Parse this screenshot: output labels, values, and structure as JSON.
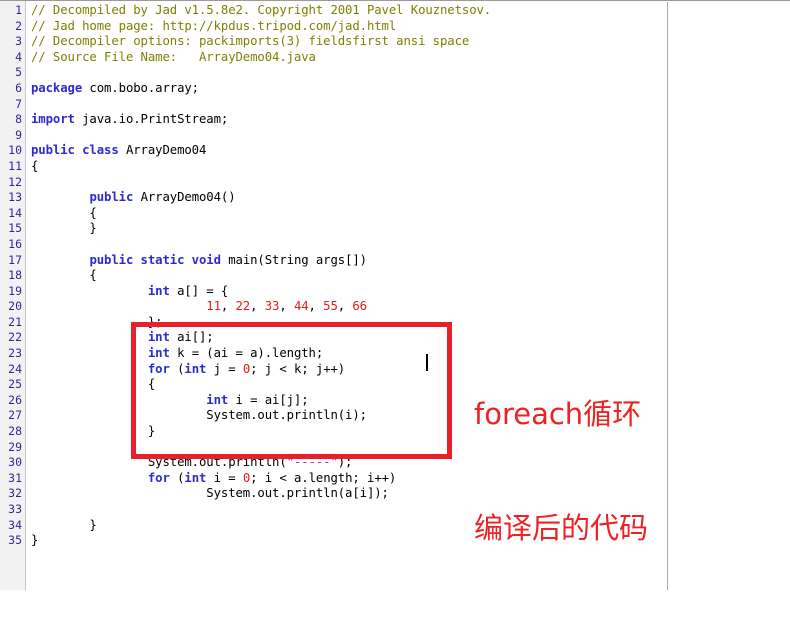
{
  "editor": {
    "file_name": "ArrayDemo04.java",
    "total_lines": 35,
    "line_numbers": [
      "1",
      "2",
      "3",
      "4",
      "5",
      "6",
      "7",
      "8",
      "9",
      "10",
      "11",
      "12",
      "13",
      "14",
      "15",
      "16",
      "17",
      "18",
      "19",
      "20",
      "21",
      "22",
      "23",
      "24",
      "25",
      "26",
      "27",
      "28",
      "29",
      "30",
      "31",
      "32",
      "33",
      "34",
      "35"
    ],
    "colors": {
      "comment": "#808000",
      "keyword": "#2b2bd0",
      "number": "#e01b1b",
      "string": "#c020c0",
      "plain": "#000000",
      "gutter_bg": "#f2f2f2",
      "gutter_text": "#2b2b8f",
      "background": "#ffffff",
      "annotation_red": "#ee2222",
      "highlight_box": "#e8202a"
    },
    "lines": [
      {
        "n": "1",
        "tokens": [
          {
            "t": "comment",
            "s": "// Decompiled by Jad v1.5.8e2. Copyright 2001 Pavel Kouznetsov."
          }
        ]
      },
      {
        "n": "2",
        "tokens": [
          {
            "t": "comment",
            "s": "// Jad home page: http://kpdus.tripod.com/jad.html"
          }
        ]
      },
      {
        "n": "3",
        "tokens": [
          {
            "t": "comment",
            "s": "// Decompiler options: packimports(3) fieldsfirst ansi space"
          }
        ]
      },
      {
        "n": "4",
        "tokens": [
          {
            "t": "comment",
            "s": "// Source File Name:   ArrayDemo04.java"
          }
        ]
      },
      {
        "n": "5",
        "tokens": [
          {
            "t": "plain",
            "s": ""
          }
        ]
      },
      {
        "n": "6",
        "tokens": [
          {
            "t": "keyword",
            "s": "package"
          },
          {
            "t": "plain",
            "s": " com.bobo.array;"
          }
        ]
      },
      {
        "n": "7",
        "tokens": [
          {
            "t": "plain",
            "s": ""
          }
        ]
      },
      {
        "n": "8",
        "tokens": [
          {
            "t": "keyword",
            "s": "import"
          },
          {
            "t": "plain",
            "s": " java.io.PrintStream;"
          }
        ]
      },
      {
        "n": "9",
        "tokens": [
          {
            "t": "plain",
            "s": ""
          }
        ]
      },
      {
        "n": "10",
        "tokens": [
          {
            "t": "keyword",
            "s": "public class"
          },
          {
            "t": "plain",
            "s": " ArrayDemo04"
          }
        ]
      },
      {
        "n": "11",
        "tokens": [
          {
            "t": "plain",
            "s": "{"
          }
        ]
      },
      {
        "n": "12",
        "tokens": [
          {
            "t": "plain",
            "s": ""
          }
        ]
      },
      {
        "n": "13",
        "tokens": [
          {
            "t": "plain",
            "s": "        "
          },
          {
            "t": "keyword",
            "s": "public"
          },
          {
            "t": "plain",
            "s": " ArrayDemo04()"
          }
        ]
      },
      {
        "n": "14",
        "tokens": [
          {
            "t": "plain",
            "s": "        {"
          }
        ]
      },
      {
        "n": "15",
        "tokens": [
          {
            "t": "plain",
            "s": "        }"
          }
        ]
      },
      {
        "n": "16",
        "tokens": [
          {
            "t": "plain",
            "s": ""
          }
        ]
      },
      {
        "n": "17",
        "tokens": [
          {
            "t": "plain",
            "s": "        "
          },
          {
            "t": "keyword",
            "s": "public static void"
          },
          {
            "t": "plain",
            "s": " main(String args[])"
          }
        ]
      },
      {
        "n": "18",
        "tokens": [
          {
            "t": "plain",
            "s": "        {"
          }
        ]
      },
      {
        "n": "19",
        "tokens": [
          {
            "t": "plain",
            "s": "                "
          },
          {
            "t": "keyword",
            "s": "int"
          },
          {
            "t": "plain",
            "s": " a[] = {"
          }
        ]
      },
      {
        "n": "20",
        "tokens": [
          {
            "t": "plain",
            "s": "                        "
          },
          {
            "t": "number",
            "s": "11"
          },
          {
            "t": "plain",
            "s": ", "
          },
          {
            "t": "number",
            "s": "22"
          },
          {
            "t": "plain",
            "s": ", "
          },
          {
            "t": "number",
            "s": "33"
          },
          {
            "t": "plain",
            "s": ", "
          },
          {
            "t": "number",
            "s": "44"
          },
          {
            "t": "plain",
            "s": ", "
          },
          {
            "t": "number",
            "s": "55"
          },
          {
            "t": "plain",
            "s": ", "
          },
          {
            "t": "number",
            "s": "66"
          }
        ]
      },
      {
        "n": "21",
        "tokens": [
          {
            "t": "plain",
            "s": "                };"
          }
        ]
      },
      {
        "n": "22",
        "tokens": [
          {
            "t": "plain",
            "s": "                "
          },
          {
            "t": "keyword",
            "s": "int"
          },
          {
            "t": "plain",
            "s": " ai[];"
          }
        ]
      },
      {
        "n": "23",
        "tokens": [
          {
            "t": "plain",
            "s": "                "
          },
          {
            "t": "keyword",
            "s": "int"
          },
          {
            "t": "plain",
            "s": " k = (ai = a).length;"
          }
        ]
      },
      {
        "n": "24",
        "tokens": [
          {
            "t": "plain",
            "s": "                "
          },
          {
            "t": "keyword",
            "s": "for"
          },
          {
            "t": "plain",
            "s": " ("
          },
          {
            "t": "keyword",
            "s": "int"
          },
          {
            "t": "plain",
            "s": " j = "
          },
          {
            "t": "number",
            "s": "0"
          },
          {
            "t": "plain",
            "s": "; j < k; j++)"
          }
        ]
      },
      {
        "n": "25",
        "tokens": [
          {
            "t": "plain",
            "s": "                {"
          }
        ]
      },
      {
        "n": "26",
        "tokens": [
          {
            "t": "plain",
            "s": "                        "
          },
          {
            "t": "keyword",
            "s": "int"
          },
          {
            "t": "plain",
            "s": " i = ai[j];"
          }
        ]
      },
      {
        "n": "27",
        "tokens": [
          {
            "t": "plain",
            "s": "                        System.out.println(i);"
          }
        ]
      },
      {
        "n": "28",
        "tokens": [
          {
            "t": "plain",
            "s": "                }"
          }
        ]
      },
      {
        "n": "29",
        "tokens": [
          {
            "t": "plain",
            "s": ""
          }
        ]
      },
      {
        "n": "30",
        "tokens": [
          {
            "t": "plain",
            "s": "                System.out.println("
          },
          {
            "t": "string",
            "s": "\"-----\""
          },
          {
            "t": "plain",
            "s": ");"
          }
        ]
      },
      {
        "n": "31",
        "tokens": [
          {
            "t": "plain",
            "s": "                "
          },
          {
            "t": "keyword",
            "s": "for"
          },
          {
            "t": "plain",
            "s": " ("
          },
          {
            "t": "keyword",
            "s": "int"
          },
          {
            "t": "plain",
            "s": " i = "
          },
          {
            "t": "number",
            "s": "0"
          },
          {
            "t": "plain",
            "s": "; i < a.length; i++)"
          }
        ]
      },
      {
        "n": "32",
        "tokens": [
          {
            "t": "plain",
            "s": "                        System.out.println(a[i]);"
          }
        ]
      },
      {
        "n": "33",
        "tokens": [
          {
            "t": "plain",
            "s": ""
          }
        ]
      },
      {
        "n": "34",
        "tokens": [
          {
            "t": "plain",
            "s": "        }"
          }
        ]
      },
      {
        "n": "35",
        "tokens": [
          {
            "t": "plain",
            "s": "}"
          }
        ]
      }
    ]
  },
  "annotation": {
    "note_line_1": "foreach循环",
    "note_line_2": "编译后的代码",
    "highlight_box_label": "foreach-compiled-code-highlight"
  }
}
